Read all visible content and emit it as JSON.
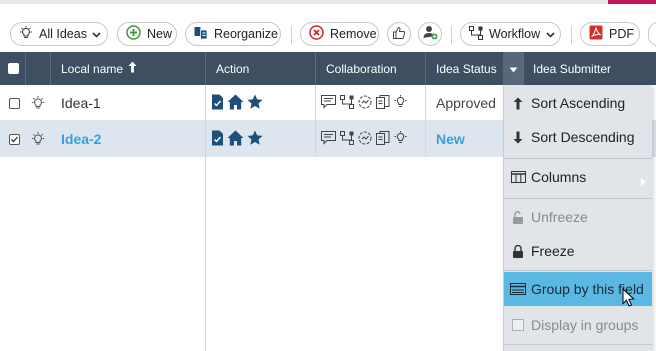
{
  "toolbar": {
    "all_ideas": "All Ideas",
    "new": "New",
    "reorganize": "Reorganize",
    "remove": "Remove",
    "workflow": "Workflow",
    "pdf": "PDF"
  },
  "grid": {
    "headers": {
      "local_name": "Local name",
      "action": "Action",
      "collaboration": "Collaboration",
      "idea_status": "Idea Status",
      "idea_submitter": "Idea Submitter"
    },
    "rows": [
      {
        "name": "Idea-1",
        "status": "Approved",
        "selected": false
      },
      {
        "name": "Idea-2",
        "status": "New",
        "selected": true
      }
    ]
  },
  "context_menu": {
    "sort_ascending": "Sort Ascending",
    "sort_descending": "Sort Descending",
    "columns": "Columns",
    "unfreeze": "Unfreeze",
    "freeze": "Freeze",
    "group_by_field": "Group by this field",
    "display_in_groups": "Display in groups"
  },
  "colors": {
    "header_bg": "#3d4f60",
    "selected_row_bg": "#dde5ee",
    "link_blue": "#3aa0d8",
    "menu_highlight": "#5bb8e2",
    "icon_navy": "#1e4f7a",
    "brand_magenta": "#c2185b"
  }
}
